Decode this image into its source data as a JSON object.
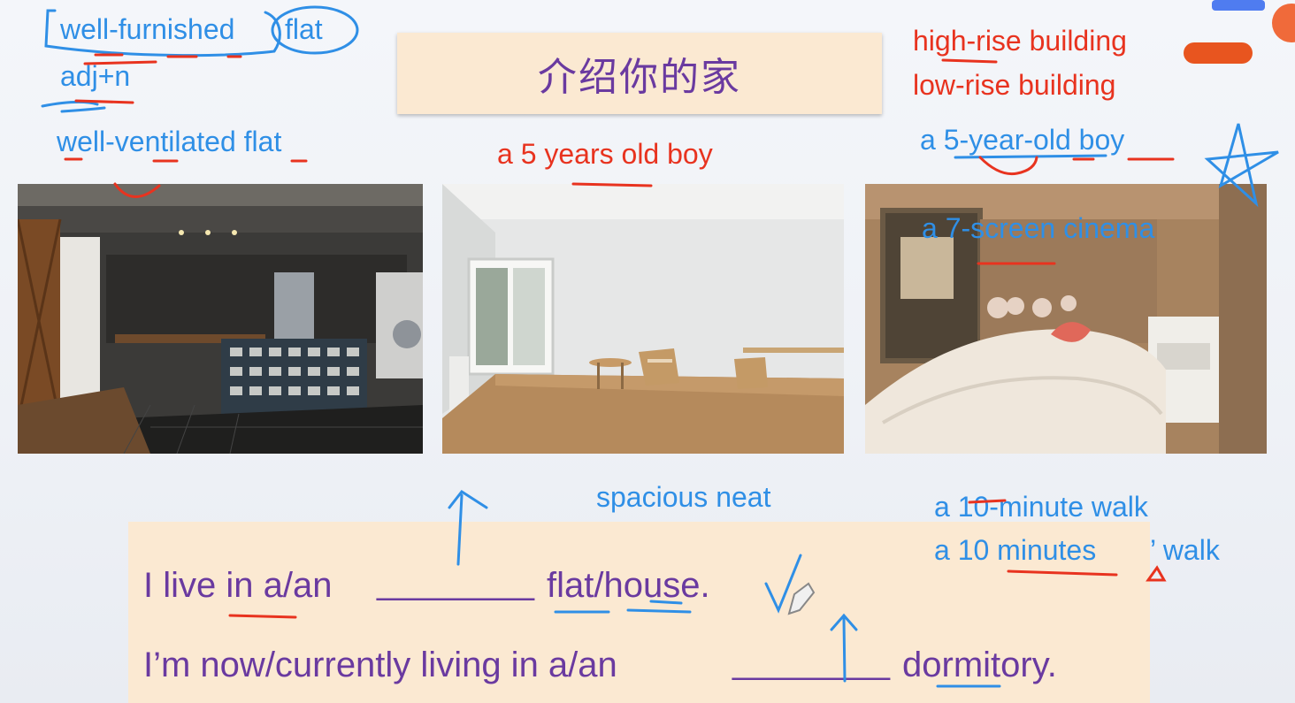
{
  "slide": {
    "title": "介绍你的家"
  },
  "notes": {
    "well_furnished": "well-furnished",
    "flat": "flat",
    "adj_n": "adj+n",
    "well_ventilated": "well-ventilated flat",
    "years_old_wrong": "a 5 years old boy",
    "high_rise": "high-rise building",
    "low_rise": "low-rise building",
    "year_old_right": "a 5-year-old boy",
    "cinema": "a 7-screen cinema",
    "spacious": "spacious neat",
    "minute_walk": "a 10-minute walk",
    "minutes_walk_a": "a 10 minutes",
    "minutes_walk_b": "’ walk"
  },
  "sentences": {
    "line1_a": "I live in a/an",
    "line1_blank": "________",
    "line1_b": "flat/house.",
    "line2_a": "I’m now/currently living in a/an",
    "line2_blank": "________",
    "line2_b": "dormitory."
  },
  "photos": [
    {
      "name": "kitchen"
    },
    {
      "name": "empty-living-room"
    },
    {
      "name": "cozy-bedroom"
    }
  ],
  "colors": {
    "annotation_blue": "#2f8fe6",
    "annotation_red": "#e8331f",
    "slide_purple": "#6a3aa0",
    "box_peach": "#fbe9d2"
  }
}
